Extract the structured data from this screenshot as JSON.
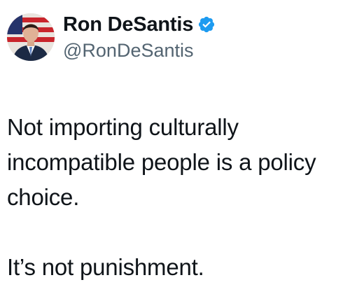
{
  "tweet": {
    "author": {
      "display_name": "Ron DeSantis",
      "handle": "@RonDeSantis",
      "verified": true,
      "verified_icon": "verified-badge-icon",
      "verified_color": "#1d9bf0"
    },
    "text": {
      "paragraph_1": "Not importing culturally incompatible people is a policy choice.",
      "paragraph_2": "It’s not punishment."
    }
  },
  "colors": {
    "text": "#0f1419",
    "secondary_text": "#536471",
    "background": "#ffffff"
  }
}
